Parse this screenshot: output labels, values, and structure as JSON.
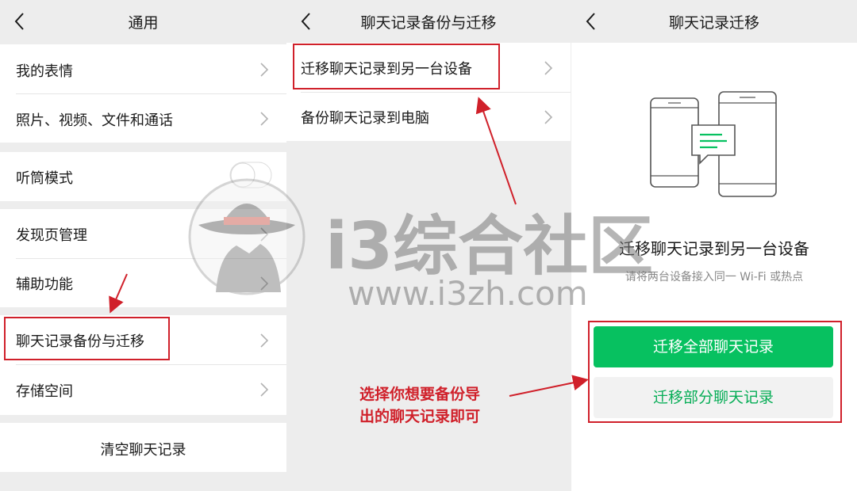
{
  "panel1": {
    "title": "通用",
    "items": [
      {
        "label": "我的表情"
      },
      {
        "label": "照片、视频、文件和通话"
      },
      {
        "label": "听筒模式"
      },
      {
        "label": "发现页管理"
      },
      {
        "label": "辅助功能"
      },
      {
        "label": "聊天记录备份与迁移"
      },
      {
        "label": "存储空间"
      }
    ],
    "clear_label": "清空聊天记录"
  },
  "panel2": {
    "title": "聊天记录备份与迁移",
    "items": [
      {
        "label": "迁移聊天记录到另一台设备"
      },
      {
        "label": "备份聊天记录到电脑"
      }
    ]
  },
  "panel3": {
    "title": "聊天记录迁移",
    "heading": "迁移聊天记录到另一台设备",
    "subtext": "请将两台设备接入同一 Wi-Fi 或热点",
    "primary_button": "迁移全部聊天记录",
    "secondary_button": "迁移部分聊天记录"
  },
  "annotation": {
    "line1": "选择你想要备份导",
    "line2": "出的聊天记录即可"
  },
  "watermark": {
    "name": "i3综合社区",
    "url": "www.i3zh.com"
  },
  "colors": {
    "highlight": "#d0202a",
    "wechat_green": "#07c160",
    "background": "#ededed"
  }
}
